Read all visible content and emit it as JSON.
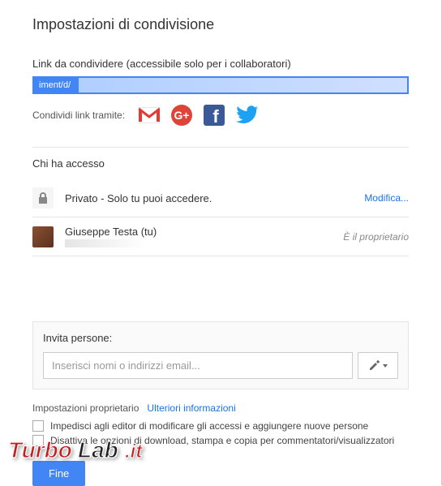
{
  "title": "Impostazioni di condivisione",
  "shareLink": {
    "label": "Link da condividere (accessibile solo per i collaboratori)",
    "value": "iment/d/"
  },
  "shareVia": {
    "label": "Condividi link tramite:",
    "icons": [
      "gmail-icon",
      "googleplus-icon",
      "facebook-icon",
      "twitter-icon"
    ]
  },
  "access": {
    "title": "Chi ha accesso",
    "rows": [
      {
        "type": "privacy",
        "text": "Privato - Solo tu puoi accedere.",
        "action": "Modifica..."
      },
      {
        "type": "user",
        "name": "Giuseppe Testa (tu)",
        "right": "È il proprietario"
      }
    ]
  },
  "invite": {
    "label": "Invita persone:",
    "placeholder": "Inserisci nomi o indirizzi email..."
  },
  "ownerSettings": {
    "title": "Impostazioni proprietario",
    "moreInfo": "Ulteriori informazioni",
    "opt1": "Impedisci agli editor di modificare gli accessi e aggiungere nuove persone",
    "opt2": "Disattiva le opzioni di download, stampa e copia per commentatori/visualizzatori"
  },
  "doneBtn": "Fine",
  "watermark": "TurboLab.it"
}
